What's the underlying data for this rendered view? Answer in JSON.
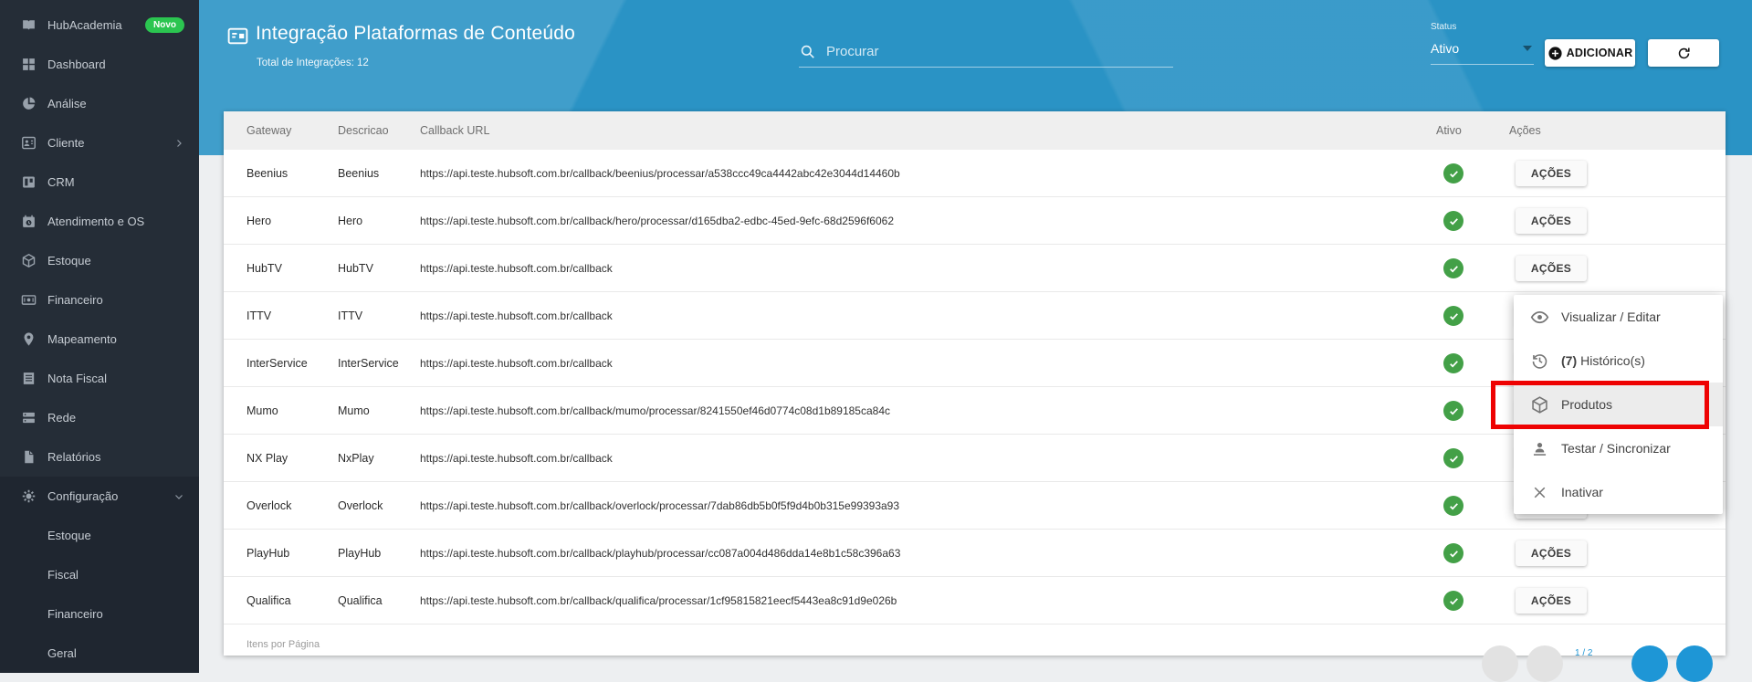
{
  "colors": {
    "topbar_blue": "#2a93c5",
    "sidebar_dark": "#252d37",
    "badge_green": "#2bc550",
    "check_green": "#43a047",
    "annotation_red": "#ee0202",
    "pagination_blue": "#1e96d6"
  },
  "sidebar": {
    "items": [
      {
        "label": "HubAcademia",
        "icon": "book-open-icon",
        "badge": "Novo"
      },
      {
        "label": "Dashboard",
        "icon": "dashboard-grid-icon"
      },
      {
        "label": "Análise",
        "icon": "pie-chart-icon"
      },
      {
        "label": "Cliente",
        "icon": "person-card-icon",
        "chevron": "right"
      },
      {
        "label": "CRM",
        "icon": "kanban-icon"
      },
      {
        "label": "Atendimento e OS",
        "icon": "calendar-clock-icon"
      },
      {
        "label": "Estoque",
        "icon": "cube-icon"
      },
      {
        "label": "Financeiro",
        "icon": "banknote-icon"
      },
      {
        "label": "Mapeamento",
        "icon": "map-pin-icon"
      },
      {
        "label": "Nota Fiscal",
        "icon": "document-icon"
      },
      {
        "label": "Rede",
        "icon": "server-icon"
      },
      {
        "label": "Relatórios",
        "icon": "file-icon"
      },
      {
        "label": "Configuração",
        "icon": "gear-icon",
        "chevron": "down"
      }
    ],
    "config_children": [
      {
        "label": "Estoque"
      },
      {
        "label": "Fiscal"
      },
      {
        "label": "Financeiro"
      },
      {
        "label": "Geral"
      }
    ]
  },
  "header": {
    "title": "Integração Plataformas de Conteúdo",
    "subtitle": "Total de Integrações: 12",
    "search_placeholder": "Procurar",
    "status_label": "Status",
    "status_value": "Ativo",
    "add_label": "ADICIONAR",
    "icons": [
      "page-title-icon",
      "search-icon",
      "plus-circle-icon",
      "refresh-icon"
    ]
  },
  "table": {
    "columns": [
      "Gateway",
      "Descricao",
      "Callback URL",
      "Ativo",
      "Ações"
    ],
    "actions_label": "AÇÕES",
    "rows": [
      {
        "gateway": "Beenius",
        "descricao": "Beenius",
        "callback_url": "https://api.teste.hubsoft.com.br/callback/beenius/processar/a538ccc49ca4442abc42e3044d14460b",
        "ativo": true
      },
      {
        "gateway": "Hero",
        "descricao": "Hero",
        "callback_url": "https://api.teste.hubsoft.com.br/callback/hero/processar/d165dba2-edbc-45ed-9efc-68d2596f6062",
        "ativo": true
      },
      {
        "gateway": "HubTV",
        "descricao": "HubTV",
        "callback_url": "https://api.teste.hubsoft.com.br/callback",
        "ativo": true
      },
      {
        "gateway": "ITTV",
        "descricao": "ITTV",
        "callback_url": "https://api.teste.hubsoft.com.br/callback",
        "ativo": true
      },
      {
        "gateway": "InterService",
        "descricao": "InterService",
        "callback_url": "https://api.teste.hubsoft.com.br/callback",
        "ativo": true
      },
      {
        "gateway": "Mumo",
        "descricao": "Mumo",
        "callback_url": "https://api.teste.hubsoft.com.br/callback/mumo/processar/8241550ef46d0774c08d1b89185ca84c",
        "ativo": true
      },
      {
        "gateway": "NX Play",
        "descricao": "NxPlay",
        "callback_url": "https://api.teste.hubsoft.com.br/callback",
        "ativo": true
      },
      {
        "gateway": "Overlock",
        "descricao": "Overlock",
        "callback_url": "https://api.teste.hubsoft.com.br/callback/overlock/processar/7dab86db5b0f5f9d4b0b315e99393a93",
        "ativo": true
      },
      {
        "gateway": "PlayHub",
        "descricao": "PlayHub",
        "callback_url": "https://api.teste.hubsoft.com.br/callback/playhub/processar/cc087a004d486dda14e8b1c58c396a63",
        "ativo": true
      },
      {
        "gateway": "Qualifica",
        "descricao": "Qualifica",
        "callback_url": "https://api.teste.hubsoft.com.br/callback/qualifica/processar/1cf95815821eecf5443ea8c91d9e026b",
        "ativo": true
      }
    ]
  },
  "menu": {
    "items": [
      {
        "icon": "eye-icon",
        "label": "Visualizar / Editar"
      },
      {
        "icon": "history-icon",
        "count": "(7)",
        "label": "Histórico(s)"
      },
      {
        "icon": "package-icon",
        "label": "Produtos",
        "highlighted": true
      },
      {
        "icon": "person-sync-icon",
        "label": "Testar / Sincronizar"
      },
      {
        "icon": "close-icon",
        "label": "Inativar"
      }
    ]
  },
  "footer": {
    "items_per_page_label": "Itens por Página",
    "page_indicator": "1 / 2"
  }
}
